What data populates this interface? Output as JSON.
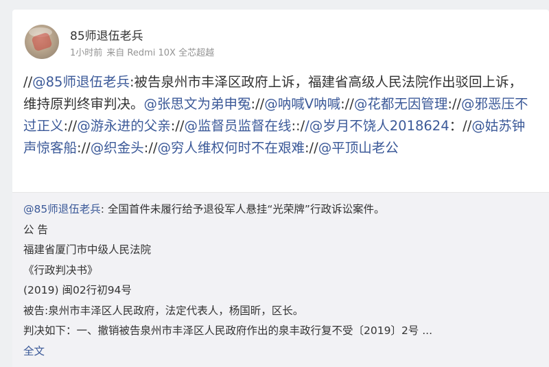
{
  "post": {
    "author": "85师退伍老兵",
    "time": "1小时前",
    "source": "来自 Redmi 10X 全芯超越",
    "segments": [
      {
        "t": "//",
        "link": false
      },
      {
        "t": "@85师退伍老兵",
        "link": true
      },
      {
        "t": ":被告泉州市丰泽区政府上诉，福建省高级人民法院作出驳回上诉，维持原判终审判决。",
        "link": false
      },
      {
        "t": "@张思文为弟申冤",
        "link": true
      },
      {
        "t": "://",
        "link": false
      },
      {
        "t": "@呐喊V呐喊",
        "link": true
      },
      {
        "t": "://",
        "link": false
      },
      {
        "t": "@花都无因管理",
        "link": true
      },
      {
        "t": "://",
        "link": false
      },
      {
        "t": "@邪恶压不过正义",
        "link": true
      },
      {
        "t": "://",
        "link": false
      },
      {
        "t": "@游永进的父亲",
        "link": true
      },
      {
        "t": "://",
        "link": false
      },
      {
        "t": "@监督员监督在线",
        "link": true
      },
      {
        "t": "::/",
        "link": false
      },
      {
        "t": "/@岁月不饶人2018624",
        "link": true
      },
      {
        "t": "：//",
        "link": false
      },
      {
        "t": "@姑苏钟声惊客船",
        "link": true
      },
      {
        "t": "://",
        "link": false
      },
      {
        "t": "@织金头",
        "link": true
      },
      {
        "t": "://",
        "link": false
      },
      {
        "t": "@穷人维权何时不在艰难",
        "link": true
      },
      {
        "t": "://",
        "link": false
      },
      {
        "t": "@平顶山老公",
        "link": true
      }
    ]
  },
  "repost": {
    "author_mention": "@85师退伍老兵",
    "first_line": ": 全国首件未履行给予退役军人悬挂“光荣牌”行政诉讼案件。",
    "lines": [
      "公 告",
      "福建省厦门市中级人民法院",
      "《行政判决书》",
      "(2019) 闽02行初94号",
      "被告:泉州市丰泽区人民政府，法定代表人，杨国昕，区长。",
      "判决如下：一、撤销被告泉州市丰泽区人民政府作出的泉丰政行复不受〔2019〕2号 ..."
    ],
    "full_text_label": "全文"
  }
}
